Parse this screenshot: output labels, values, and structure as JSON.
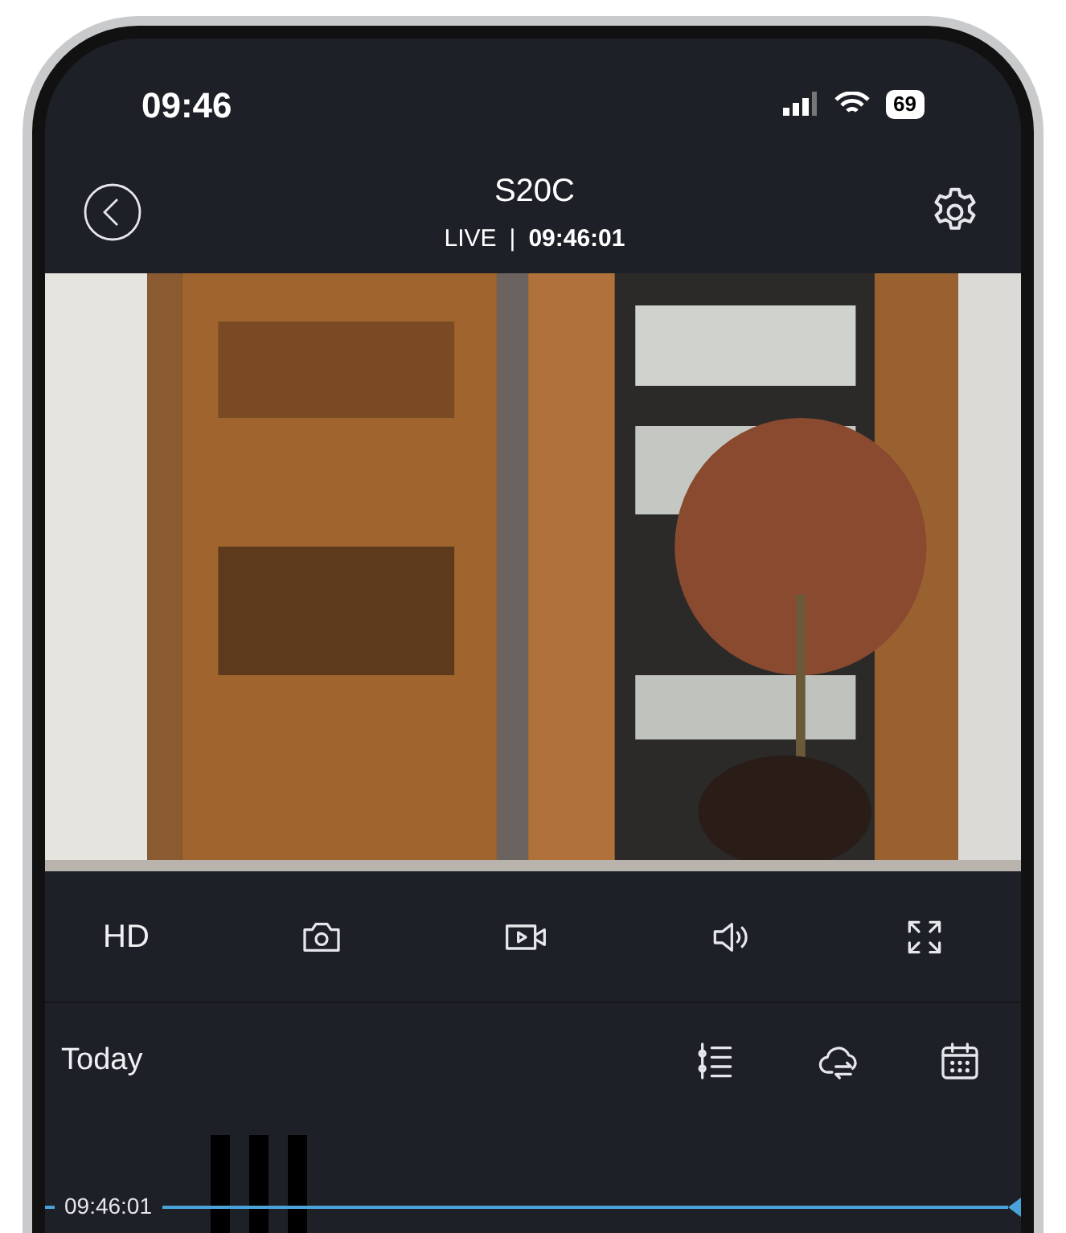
{
  "status_bar": {
    "time": "09:46",
    "battery": "69"
  },
  "header": {
    "title": "S20C",
    "live_label": "LIVE",
    "separator": "|",
    "live_time": "09:46:01"
  },
  "controls": [
    {
      "kind": "text",
      "label": "HD"
    },
    {
      "kind": "snapshot"
    },
    {
      "kind": "record"
    },
    {
      "kind": "sound"
    },
    {
      "kind": "fullscreen"
    }
  ],
  "playback": {
    "day": "Today",
    "actions": [
      {
        "kind": "events"
      },
      {
        "kind": "cloud"
      },
      {
        "kind": "calendar"
      }
    ]
  },
  "timeline": {
    "current_time": "09:46:01"
  }
}
